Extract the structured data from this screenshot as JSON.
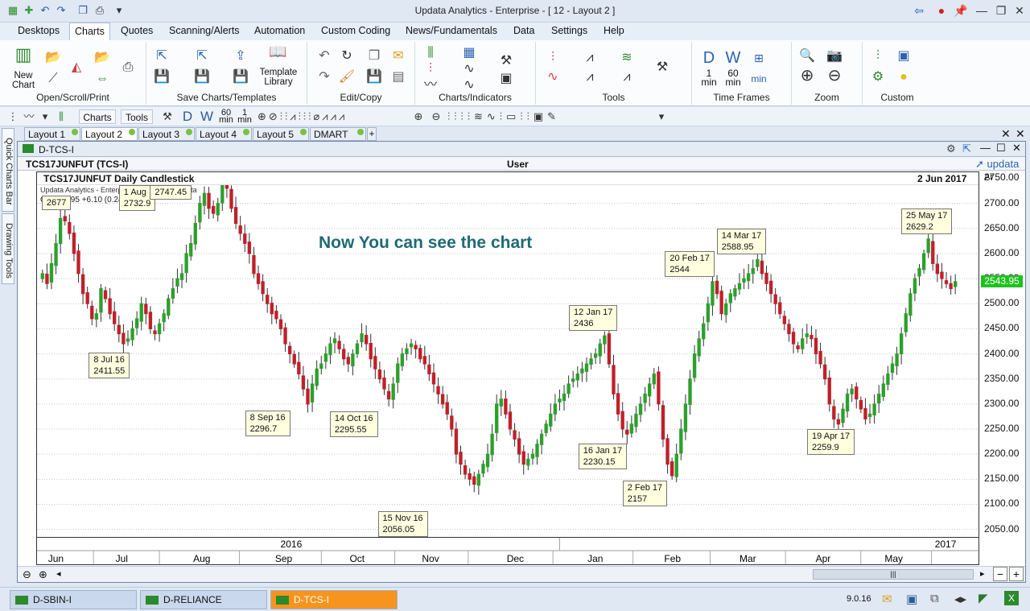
{
  "window": {
    "title": "Updata Analytics - Enterprise - [ 12 - Layout 2 ]"
  },
  "menu": [
    "Desktops",
    "Charts",
    "Quotes",
    "Scanning/Alerts",
    "Automation",
    "Custom Coding",
    "News/Fundamentals",
    "Data",
    "Settings",
    "Help"
  ],
  "ribbon": {
    "new_chart": "New\nChart",
    "template_library": "Template\nLibrary",
    "groups": [
      "Open/Scroll/Print",
      "Save Charts/Templates",
      "Edit/Copy",
      "Charts/Indicators",
      "Tools",
      "Time Frames",
      "Zoom",
      "Custom"
    ],
    "tf_d": "D",
    "tf_w": "W",
    "tf_1": "1",
    "tf_min": "min",
    "tf_60": "60"
  },
  "toolbar2": {
    "charts": "Charts",
    "tools": "Tools"
  },
  "side_tabs": [
    "Quick Charts Bar",
    "Drawing Tools"
  ],
  "layout_tabs": [
    "Layout 1",
    "Layout 2",
    "Layout 3",
    "Layout 4",
    "Layout 5",
    "DMART"
  ],
  "chart_window": {
    "title": "D-TCS-I",
    "symbol_header": "TCS17JUNFUT (TCS-I)",
    "user_label": "User",
    "brand": "updata",
    "chart_title": "TCS17JUNFUT Daily Candlestick",
    "date_label": "2 Jun 2017",
    "y_unit": "Ar",
    "watermark": "Updata Analytics - Enterprise - Data by TrueData",
    "readout_price": "C: 2543.95",
    "readout_change": "+6.10 (0.24%)",
    "overlay_text": "Now You can see the chart",
    "last_price": "2543.95"
  },
  "chart_data": {
    "type": "candlestick",
    "y_ticks": [
      2050,
      2100,
      2150,
      2200,
      2250,
      2300,
      2350,
      2400,
      2450,
      2500,
      2550,
      2600,
      2650,
      2700,
      2750
    ],
    "y_tick_labels": [
      "2050.00",
      "2100.00",
      "2150.00",
      "2200.00",
      "2250.00",
      "2300.00",
      "2350.00",
      "2400.00",
      "2450.00",
      "2500.00",
      "2550.00",
      "2600.00",
      "2650.00",
      "2700.00",
      "2750.00"
    ],
    "ylim": [
      2035,
      2762
    ],
    "x_months": [
      {
        "label": "Jun",
        "pos": 0.02
      },
      {
        "label": "Jul",
        "pos": 0.09
      },
      {
        "label": "Aug",
        "pos": 0.175
      },
      {
        "label": "Sep",
        "pos": 0.262
      },
      {
        "label": "Oct",
        "pos": 0.34
      },
      {
        "label": "Nov",
        "pos": 0.418
      },
      {
        "label": "Dec",
        "pos": 0.508
      },
      {
        "label": "Jan",
        "pos": 0.593
      },
      {
        "label": "Feb",
        "pos": 0.675
      },
      {
        "label": "Mar",
        "pos": 0.755
      },
      {
        "label": "Apr",
        "pos": 0.835
      },
      {
        "label": "May",
        "pos": 0.91
      }
    ],
    "year_labels": [
      {
        "label": "2016",
        "pos": 0.27
      },
      {
        "label": "2017",
        "pos": 0.965
      }
    ],
    "series_close": [
      2560,
      2540,
      2580,
      2620,
      2670,
      2665,
      2640,
      2600,
      2560,
      2520,
      2500,
      2470,
      2480,
      2530,
      2510,
      2480,
      2460,
      2440,
      2420,
      2430,
      2450,
      2470,
      2500,
      2480,
      2450,
      2440,
      2460,
      2480,
      2510,
      2530,
      2550,
      2560,
      2600,
      2620,
      2660,
      2700,
      2720,
      2690,
      2680,
      2700,
      2740,
      2730,
      2690,
      2660,
      2640,
      2620,
      2600,
      2560,
      2540,
      2520,
      2500,
      2480,
      2470,
      2450,
      2420,
      2400,
      2380,
      2360,
      2330,
      2300,
      2340,
      2370,
      2380,
      2400,
      2420,
      2430,
      2410,
      2390,
      2380,
      2400,
      2420,
      2440,
      2420,
      2390,
      2370,
      2350,
      2330,
      2310,
      2340,
      2380,
      2400,
      2410,
      2420,
      2410,
      2390,
      2380,
      2360,
      2340,
      2320,
      2300,
      2280,
      2250,
      2200,
      2180,
      2160,
      2150,
      2140,
      2160,
      2180,
      2200,
      2240,
      2300,
      2310,
      2280,
      2250,
      2230,
      2200,
      2180,
      2190,
      2200,
      2220,
      2240,
      2260,
      2280,
      2300,
      2310,
      2320,
      2340,
      2350,
      2360,
      2370,
      2380,
      2390,
      2400,
      2420,
      2436,
      2380,
      2320,
      2280,
      2250,
      2240,
      2260,
      2280,
      2300,
      2320,
      2340,
      2360,
      2300,
      2230,
      2180,
      2157,
      2200,
      2250,
      2300,
      2350,
      2400,
      2430,
      2460,
      2500,
      2544,
      2520,
      2480,
      2500,
      2520,
      2530,
      2540,
      2550,
      2560,
      2570,
      2588,
      2560,
      2540,
      2520,
      2500,
      2480,
      2460,
      2440,
      2420,
      2410,
      2430,
      2440,
      2430,
      2400,
      2380,
      2350,
      2300,
      2270,
      2260,
      2290,
      2320,
      2330,
      2310,
      2290,
      2270,
      2280,
      2300,
      2320,
      2340,
      2360,
      2380,
      2400,
      2440,
      2480,
      2520,
      2550,
      2570,
      2600,
      2629,
      2580,
      2560,
      2550,
      2540,
      2530,
      2544
    ],
    "annotations": [
      {
        "label": "8 Jul 16",
        "value": "2411.55"
      },
      {
        "label": "8 Sep 16",
        "value": "2296.7"
      },
      {
        "label": "14 Oct 16",
        "value": "2295.55"
      },
      {
        "label": "15 Nov 16",
        "value": "2056.05"
      },
      {
        "label": "12 Jan 17",
        "value": "2436"
      },
      {
        "label": "16 Jan 17",
        "value": "2230.15"
      },
      {
        "label": "2 Feb 17",
        "value": "2157"
      },
      {
        "label": "20 Feb 17",
        "value": "2544"
      },
      {
        "label": "14 Mar 17",
        "value": "2588.95"
      },
      {
        "label": "19 Apr 17",
        "value": "2259.9"
      },
      {
        "label": "25 May 17",
        "value": "2629.2"
      },
      {
        "label": "",
        "value": "2677"
      },
      {
        "label": "1 Aug",
        "value": "2732.9"
      },
      {
        "label": "",
        "value": "2747.45"
      }
    ]
  },
  "status": {
    "tabs": [
      "D-SBIN-I",
      "D-RELIANCE",
      "D-TCS-I"
    ],
    "version": "9.0.16"
  },
  "colors": {
    "up": "#2ca02c",
    "down": "#c0202a",
    "accent": "#f7941d",
    "last_price_bg": "#1ec21e"
  }
}
